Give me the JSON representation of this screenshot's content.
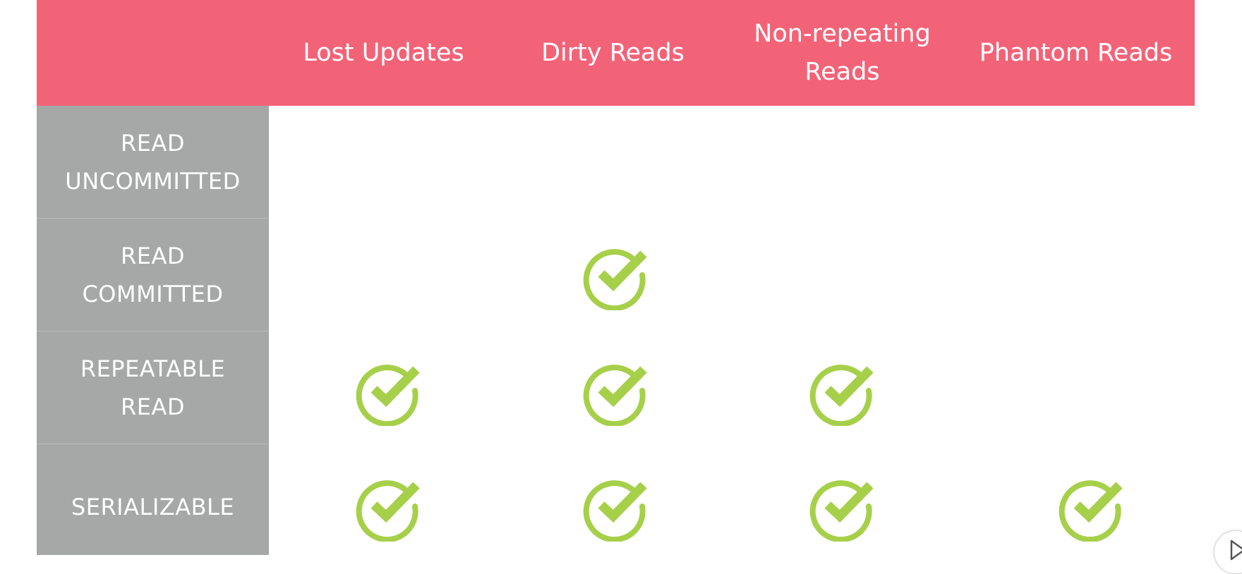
{
  "table": {
    "columns": [
      "Lost Updates",
      "Dirty Reads",
      "Non-repeating\nReads",
      "Phantom Reads"
    ],
    "rows": [
      {
        "label": "READ\nUNCOMMITTED",
        "checks": [
          false,
          false,
          false,
          false
        ]
      },
      {
        "label": "READ\nCOMMITTED",
        "checks": [
          false,
          true,
          false,
          false
        ]
      },
      {
        "label": "REPEATABLE\nREAD",
        "checks": [
          true,
          true,
          true,
          false
        ]
      },
      {
        "label": "SERIALIZABLE",
        "checks": [
          true,
          true,
          true,
          true
        ]
      }
    ]
  },
  "colors": {
    "header_bg": "#f36378",
    "row_header_bg": "#a5a8a7",
    "check": "#a6d04a"
  },
  "icons": {
    "check": "check-circle-icon",
    "corner": "play-icon"
  }
}
